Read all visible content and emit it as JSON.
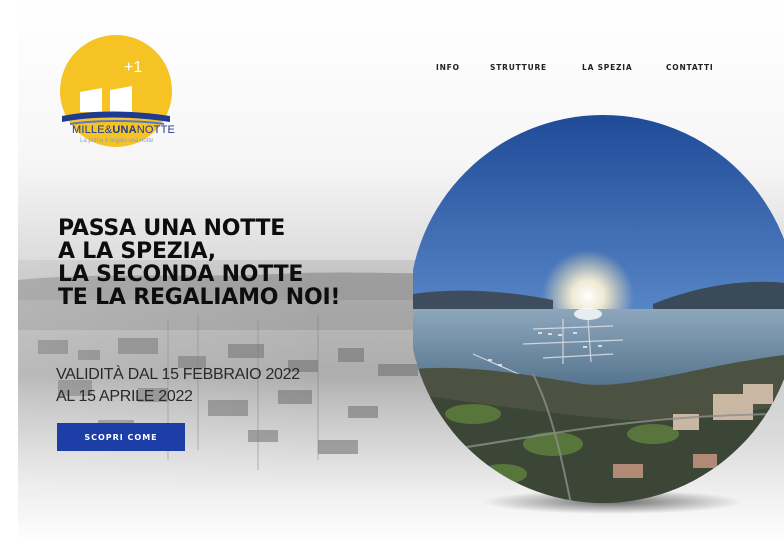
{
  "brand": {
    "name_part1": "MILLE&",
    "name_part2": "UNA",
    "name_part3": "NOTTE",
    "tagline": "La prima è regalo una notte"
  },
  "nav": {
    "items": [
      {
        "label": "INFO"
      },
      {
        "label": "STRUTTURE"
      },
      {
        "label": "LA SPEZIA"
      },
      {
        "label": "CONTATTI"
      }
    ]
  },
  "hero": {
    "headline_lines": [
      "PASSA UNA NOTTE",
      "A LA SPEZIA,",
      "LA SECONDA NOTTE",
      "TE LA REGALIAMO NOI!"
    ],
    "validity_lines": [
      "VALIDITÀ DAL 15 FEBBRAIO 2022",
      "AL 15 APRILE 2022"
    ],
    "cta_label": "SCOPRI COME"
  },
  "colors": {
    "brand_blue": "#1d3ea6",
    "sun_yellow": "#f6c325",
    "text_dark": "#0d0d0d"
  }
}
